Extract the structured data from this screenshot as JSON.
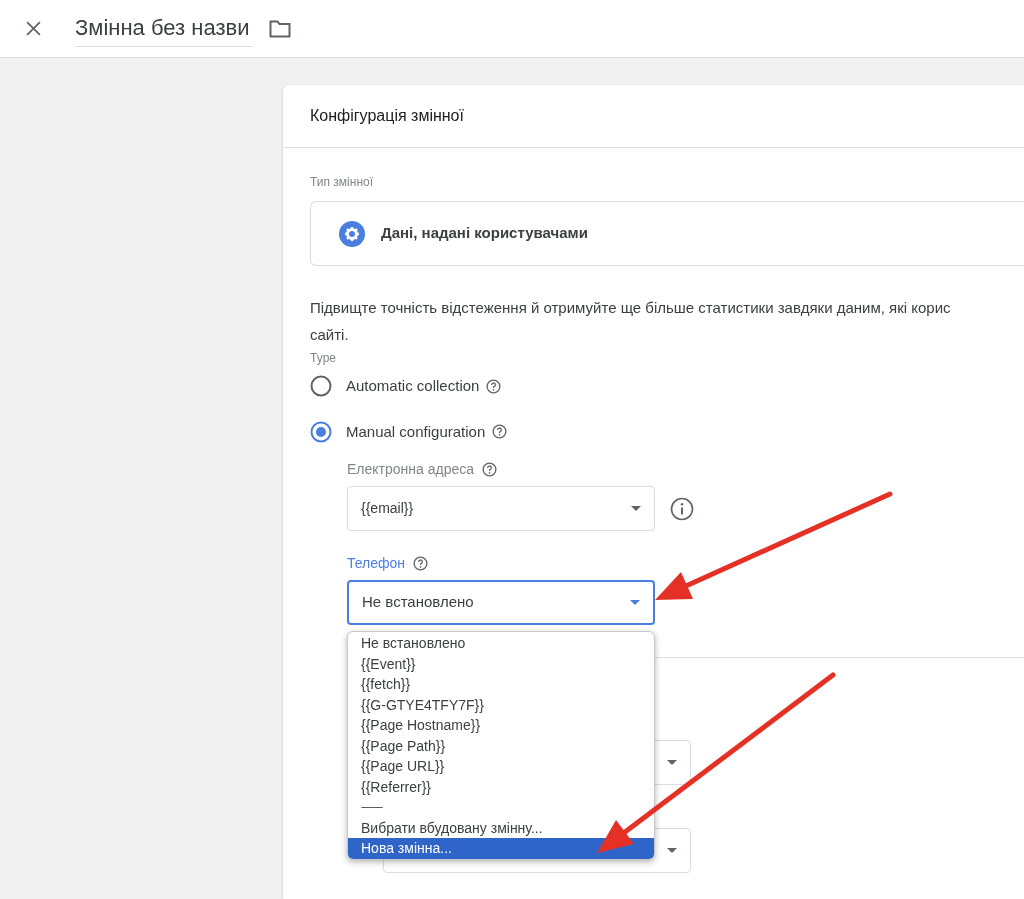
{
  "header": {
    "title": "Змінна без назви"
  },
  "card": {
    "title": "Конфігурація змінної",
    "type_label": "Тип змінної",
    "type_name": "Дані, надані користувачами",
    "description_lines": [
      "Підвищте точність відстеження й отримуйте ще більше статистики завдяки даним, які корис",
      "сайті."
    ],
    "type_group_label": "Type",
    "radios": [
      {
        "label": "Automatic collection",
        "selected": false
      },
      {
        "label": "Manual configuration",
        "selected": true
      }
    ],
    "email": {
      "label": "Електронна адреса",
      "value": "{{email}}"
    },
    "phone": {
      "label": "Телефон",
      "value": "Не встановлено",
      "focused": true
    },
    "dropdown": [
      {
        "kind": "option",
        "text": "Не встановлено",
        "selected": false
      },
      {
        "kind": "option",
        "text": "{{Event}}",
        "selected": false
      },
      {
        "kind": "option",
        "text": "{{fetch}}",
        "selected": false
      },
      {
        "kind": "option",
        "text": "{{G-GTYE4TFY7F}}",
        "selected": false
      },
      {
        "kind": "option",
        "text": "{{Page Hostname}}",
        "selected": false
      },
      {
        "kind": "option",
        "text": "{{Page Path}}",
        "selected": false
      },
      {
        "kind": "option",
        "text": "{{Page URL}}",
        "selected": false
      },
      {
        "kind": "option",
        "text": "{{Referrer}}",
        "selected": false
      },
      {
        "kind": "separator",
        "text": "---------",
        "selected": false
      },
      {
        "kind": "option",
        "text": "Вибрати вбудовану змінну...",
        "selected": false
      },
      {
        "kind": "option",
        "text": "Нова змінна...",
        "selected": true
      }
    ]
  }
}
